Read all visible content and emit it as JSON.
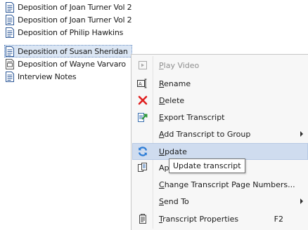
{
  "tree": {
    "items": [
      {
        "label": "Deposition of Joan Turner Vol 2",
        "icon": "document-icon"
      },
      {
        "label": "Deposition of Joan Turner Vol 2",
        "icon": "document-icon"
      },
      {
        "label": "Deposition of Philip Hawkins",
        "icon": "document-icon"
      },
      {
        "label": "Deposition of Susan Sheridan",
        "icon": "document-icon",
        "selected": true
      },
      {
        "label": "Deposition of Wayne Varvaro",
        "icon": "video-document-icon"
      },
      {
        "label": "Interview Notes",
        "icon": "document-icon"
      }
    ]
  },
  "menu": {
    "play_video": {
      "pre": "",
      "u": "P",
      "post": "lay Video"
    },
    "rename": {
      "pre": "",
      "u": "R",
      "post": "ename"
    },
    "delete": {
      "pre": "",
      "u": "D",
      "post": "elete"
    },
    "export": {
      "pre": "",
      "u": "E",
      "post": "xport Transcript"
    },
    "add_group": {
      "pre": "",
      "u": "A",
      "post": "dd Transcript to Group"
    },
    "update": {
      "pre": "",
      "u": "U",
      "post": "pdate"
    },
    "ap": {
      "pre": "Ap",
      "u": "",
      "post": ""
    },
    "change_pages": {
      "pre": "",
      "u": "C",
      "post": "hange Transcript Page Numbers..."
    },
    "send_to": {
      "pre": "",
      "u": "S",
      "post": "end To"
    },
    "properties": {
      "pre": "",
      "u": "T",
      "post": "ranscript Properties",
      "shortcut": "F2"
    }
  },
  "tooltip": {
    "text": "Update transcript"
  },
  "colors": {
    "selection": "#dbe6f4",
    "highlight": "#cfdcef",
    "delete_red": "#e02020",
    "update_blue": "#2a7bd6"
  }
}
